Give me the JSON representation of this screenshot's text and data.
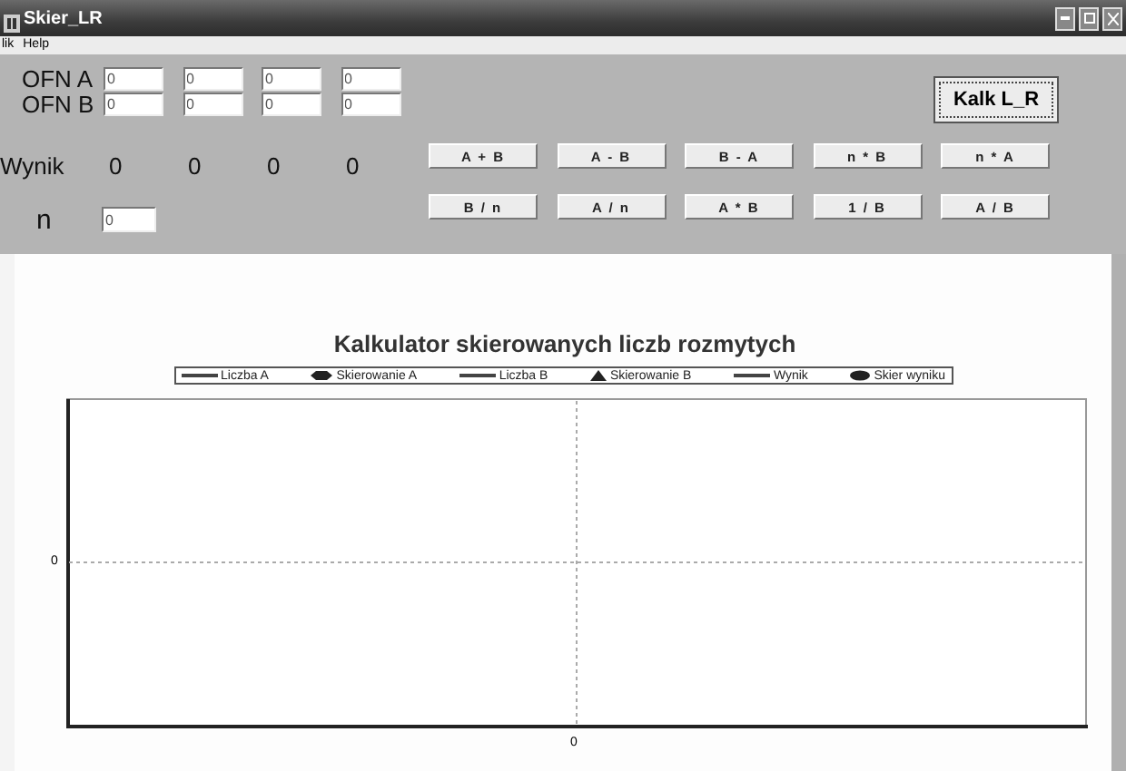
{
  "window": {
    "title": "Skier_LR"
  },
  "menu": [
    {
      "label": "lik"
    },
    {
      "label": "Help"
    }
  ],
  "inputs": [
    {
      "label": "OFN A",
      "values": [
        "0",
        "0",
        "0",
        "0"
      ]
    },
    {
      "label": "OFN B",
      "values": [
        "0",
        "0",
        "0",
        "0"
      ]
    }
  ],
  "result": {
    "label": "Wynik",
    "values": [
      "0",
      "0",
      "0",
      "0"
    ]
  },
  "n": {
    "label": "n",
    "value": "0"
  },
  "kalk_button": {
    "label": "Kalk L_R",
    "focused": true
  },
  "operation_buttons": [
    [
      "A + B",
      "A - B",
      "B - A",
      "n * B",
      "n * A"
    ],
    [
      "B / n",
      "A / n",
      "A * B",
      "1 / B",
      "A / B"
    ]
  ],
  "chart": {
    "title": "Kalkulator skierowanych liczb rozmytych",
    "legend": [
      {
        "label": "Liczba A",
        "kind": "line"
      },
      {
        "label": "Skierowanie A",
        "kind": "diamond"
      },
      {
        "label": "Liczba B",
        "kind": "line"
      },
      {
        "label": "Skierowanie B",
        "kind": "triangle"
      },
      {
        "label": "Wynik",
        "kind": "line"
      },
      {
        "label": "Skier wyniku",
        "kind": "oval"
      }
    ],
    "y_tick": "0",
    "x_tick": "0"
  }
}
